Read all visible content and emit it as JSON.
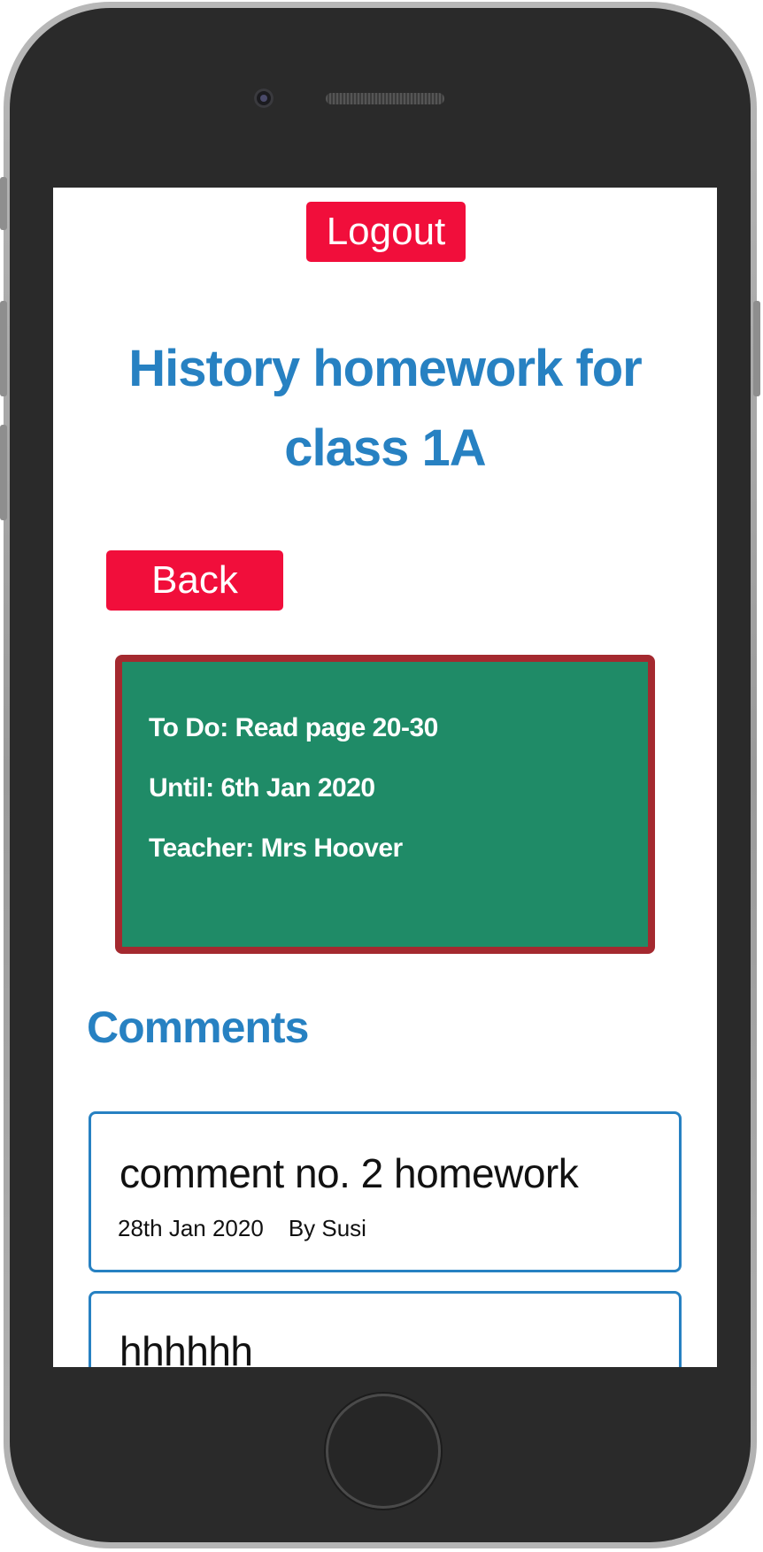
{
  "header": {
    "logout_label": "Logout"
  },
  "page": {
    "title": "History homework for class 1A",
    "back_label": "Back"
  },
  "homework": {
    "todo": "To Do: Read page 20-30",
    "until": "Until: 6th Jan 2020",
    "teacher": "Teacher: Mrs Hoover"
  },
  "comments": {
    "heading": "Comments",
    "items": [
      {
        "text": "comment no. 2 homework",
        "date": "28th Jan 2020",
        "author": "By Susi"
      },
      {
        "text": "hhhhhh",
        "date": "",
        "author": ""
      }
    ]
  },
  "colors": {
    "accent_red": "#f10e3b",
    "title_blue": "#2781c2",
    "card_green": "#1f8b67",
    "card_border": "#a4292f"
  },
  "icons": {
    "front_camera": "camera-icon",
    "speaker": "speaker-grille-icon",
    "home": "home-button-icon"
  }
}
